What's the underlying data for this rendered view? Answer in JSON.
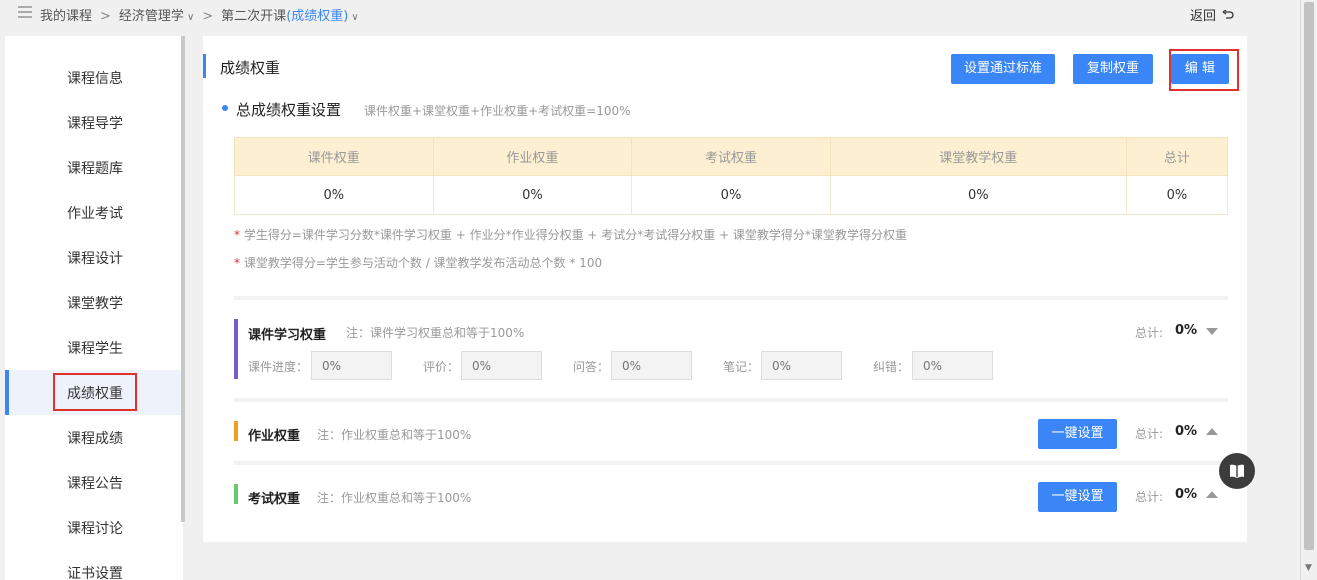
{
  "breadcrumb": {
    "items": [
      "我的课程",
      "经济管理学",
      "第二次开课"
    ],
    "current_suffix": "(成绩权重)",
    "back_label": "返回"
  },
  "sidebar": {
    "items": [
      {
        "label": "课程信息"
      },
      {
        "label": "课程导学"
      },
      {
        "label": "课程题库"
      },
      {
        "label": "作业考试"
      },
      {
        "label": "课程设计"
      },
      {
        "label": "课堂教学"
      },
      {
        "label": "课程学生"
      },
      {
        "label": "成绩权重",
        "active": true
      },
      {
        "label": "课程成绩"
      },
      {
        "label": "课程公告"
      },
      {
        "label": "课程讨论"
      },
      {
        "label": "证书设置"
      }
    ]
  },
  "main": {
    "title": "成绩权重",
    "buttons": {
      "pass_standard": "设置通过标准",
      "copy_weight": "复制权重",
      "edit": "编 辑"
    },
    "summary": {
      "title": "总成绩权重设置",
      "formula": "课件权重+课堂权重+作业权重+考试权重=100%",
      "headers": [
        "课件权重",
        "作业权重",
        "考试权重",
        "课堂教学权重",
        "总计"
      ],
      "values": [
        "0%",
        "0%",
        "0%",
        "0%",
        "0%"
      ]
    },
    "notes": [
      "学生得分=课件学习分数*课件学习权重 + 作业分*作业得分权重 + 考试分*考试得分权重 + 课堂教学得分*课堂教学得分权重",
      "课堂教学得分=学生参与活动个数 / 课堂教学发布活动总个数 * 100"
    ],
    "sections": {
      "courseware": {
        "title": "课件学习权重",
        "note": "注：课件学习权重总和等于100%",
        "total_label": "总计:",
        "total_value": "0%",
        "fields": [
          {
            "label": "课件进度：",
            "placeholder": "0%"
          },
          {
            "label": "评价：",
            "placeholder": "0%"
          },
          {
            "label": "问答：",
            "placeholder": "0%"
          },
          {
            "label": "笔记：",
            "placeholder": "0%"
          },
          {
            "label": "纠错：",
            "placeholder": "0%"
          }
        ]
      },
      "homework": {
        "title": "作业权重",
        "note": "注：作业权重总和等于100%",
        "button": "一键设置",
        "total_label": "总计:",
        "total_value": "0%"
      },
      "exam": {
        "title": "考试权重",
        "note": "注：作业权重总和等于100%",
        "button": "一键设置",
        "total_label": "总计:",
        "total_value": "0%"
      }
    }
  },
  "colors": {
    "accent": "#3a86f7",
    "highlight_border": "#e03030",
    "table_header_bg": "#fdefd2",
    "courseware_bar": "#7a5cc8",
    "homework_bar": "#f0a020",
    "exam_bar": "#6cc86c"
  },
  "icons": {
    "menu": "menu-icon",
    "back": "back-arrow-icon",
    "collapse": "triangle-down-icon",
    "expand": "triangle-up-icon",
    "float": "book-icon"
  }
}
